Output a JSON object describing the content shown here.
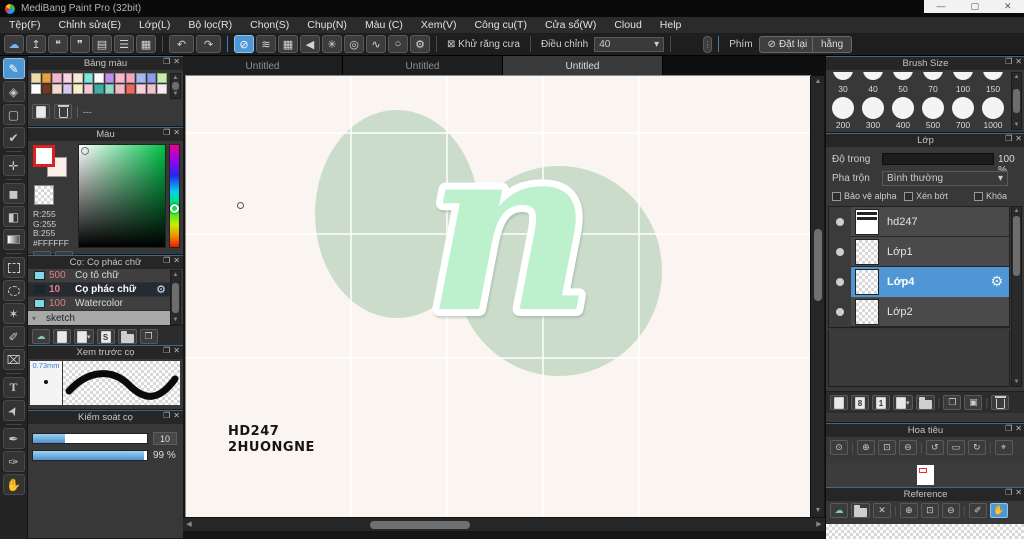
{
  "window": {
    "title": "MediBang Paint Pro (32bit)"
  },
  "menu": {
    "items": [
      "Tệp(F)",
      "Chỉnh sửa(E)",
      "Lớp(L)",
      "Bộ lọc(R)",
      "Chọn(S)",
      "Chụp(N)",
      "Màu (C)",
      "Xem(V)",
      "Công cụ(T)",
      "Cửa sổ(W)",
      "Cloud",
      "Help"
    ]
  },
  "toolbar": {
    "group1_icons": [
      "cloud-sync",
      "publish",
      "comment",
      "chat",
      "document",
      "list-settings",
      "grid-edit"
    ],
    "history_icons": [
      "undo",
      "redo"
    ],
    "snap_icons": [
      "snap-off",
      "snap-parallel",
      "snap-grid",
      "snap-vanishing-point",
      "snap-radial",
      "snap-concentric",
      "snap-curve",
      "snap-ellipse",
      "snap-settings"
    ],
    "antialias_label": "Khử răng cưa",
    "adjust_label": "Điều chỉnh",
    "adjust_value": "40",
    "key_label": "Phím",
    "reset_label": "Đặt lại",
    "partial_label": "hằng"
  },
  "tools": {
    "items": [
      "brush",
      "eraser",
      "shape",
      "polyline",
      "move",
      "select-rect",
      "bucket",
      "gradient",
      "marquee",
      "lasso",
      "magic-wand",
      "select-pen",
      "select-eraser",
      "text",
      "operation",
      "pen",
      "script",
      "hand"
    ],
    "active": "brush"
  },
  "tabs": {
    "items": [
      "Untitled",
      "Untitled",
      "Untitled"
    ],
    "active_index": 2
  },
  "canvas": {
    "letter": "n",
    "text_line1": "HD247",
    "text_line2": "2HUONGNE"
  },
  "panels": {
    "palette": {
      "title": "Bảng màu",
      "footer_text": "---",
      "colors": [
        "#efdcab",
        "#e7a13d",
        "#f2b4d5",
        "#f8d4e1",
        "#f4ebd2",
        "#7fe6db",
        "#fbfbfb",
        "#c18fe9",
        "#f5b7ca",
        "#f2a8bd",
        "#aab7f1",
        "#8b9ce8",
        "#c6eeab",
        "#ffffff",
        "#6e3c20",
        "#f8d9d2",
        "#d9c9f2",
        "#f6efc9",
        "#f2c9da",
        "#3fae9c",
        "#90dcc9",
        "#f2b9ca",
        "#e96a60",
        "#f8d2da",
        "#f2c2d2",
        "#f9eaf2"
      ]
    },
    "color": {
      "title": "Màu",
      "r": "R:255",
      "g": "G:255",
      "b": "B:255",
      "hex": "#FFFFFF"
    },
    "brushes": {
      "title": "Cọ: Cọ phác chữ",
      "items": [
        {
          "badge": "500",
          "name": "Cọ tô chữ",
          "badge_color": "#7fd8e8"
        },
        {
          "badge": "10",
          "name": "Cọ phác chữ",
          "badge_color": "#1b2530"
        },
        {
          "badge": "100",
          "name": "Watercolor",
          "badge_color": "#7fd8e8"
        }
      ],
      "selected_index": 1,
      "group": "sketch"
    },
    "preview": {
      "title": "Xem trước cọ",
      "size_label": "0.73mm"
    },
    "control": {
      "title": "Kiểm soát cọ",
      "slider1_value": "10",
      "slider2_value": "99 %"
    },
    "brush_size": {
      "title": "Brush Size",
      "row1": [
        "30",
        "40",
        "50",
        "70",
        "100",
        "150"
      ],
      "row2": [
        "200",
        "300",
        "400",
        "500",
        "700",
        "1000"
      ]
    },
    "layers": {
      "title": "Lớp",
      "opacity_label": "Độ trong",
      "opacity_value": "100 %",
      "blend_label": "Pha trộn",
      "blend_value": "Bình thường",
      "check_alpha": "Bảo vệ alpha",
      "check_clip": "Xén bớt",
      "check_lock": "Khóa",
      "items": [
        {
          "name": "hd247"
        },
        {
          "name": "Lớp1"
        },
        {
          "name": "Lớp4"
        },
        {
          "name": "Lớp2"
        }
      ],
      "selected_index": 2,
      "footer_icons": [
        "new-layer",
        "layer-8bit",
        "layer-1bit",
        "add-layer-menu",
        "layer-folder",
        "duplicate-layer",
        "merge-layer",
        "delete-layer"
      ]
    },
    "navigator": {
      "title": "Hoa tiêu",
      "icons": [
        "zoom-actual",
        "zoom-in",
        "fit-screen",
        "zoom-out",
        "rotate-ccw",
        "reset-view",
        "rotate-cw",
        "spin-reset"
      ]
    },
    "reference": {
      "title": "Reference",
      "icons": [
        "cloud-open",
        "open-folder",
        "clear",
        "zoom-in",
        "fit-screen",
        "zoom-out",
        "eyedropper",
        "hand"
      ],
      "active_icon": "hand"
    }
  },
  "colors": {
    "accent": "#4f97d4",
    "canvas_bg": "#faf5f0",
    "circle_green": "#cddccd",
    "letter_fill": "#bdf0cc"
  }
}
